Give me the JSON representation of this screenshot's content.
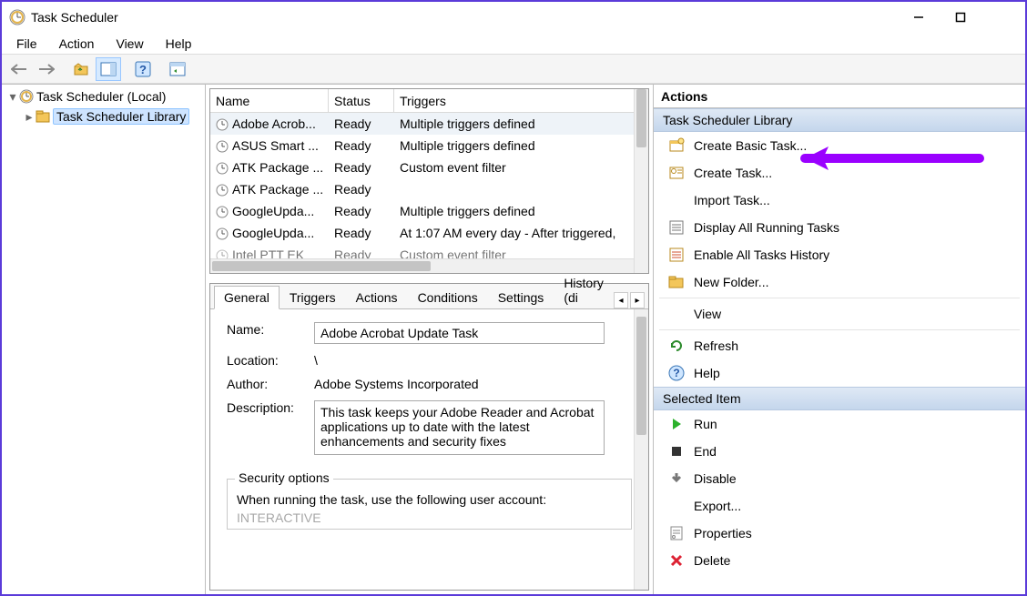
{
  "window": {
    "title": "Task Scheduler"
  },
  "menu": {
    "file": "File",
    "action": "Action",
    "view": "View",
    "help": "Help"
  },
  "tree": {
    "root": "Task Scheduler (Local)",
    "library": "Task Scheduler Library"
  },
  "table": {
    "headers": {
      "name": "Name",
      "status": "Status",
      "triggers": "Triggers"
    },
    "rows": [
      {
        "name": "Adobe Acrob...",
        "status": "Ready",
        "triggers": "Multiple triggers defined"
      },
      {
        "name": "ASUS Smart ...",
        "status": "Ready",
        "triggers": "Multiple triggers defined"
      },
      {
        "name": "ATK Package ...",
        "status": "Ready",
        "triggers": "Custom event filter"
      },
      {
        "name": "ATK Package ...",
        "status": "Ready",
        "triggers": ""
      },
      {
        "name": "GoogleUpda...",
        "status": "Ready",
        "triggers": "Multiple triggers defined"
      },
      {
        "name": "GoogleUpda...",
        "status": "Ready",
        "triggers": "At 1:07 AM every day - After triggered,"
      },
      {
        "name": "Intel PTT EK",
        "status": "Ready",
        "triggers": "Custom event filter"
      }
    ]
  },
  "details": {
    "tabs": {
      "general": "General",
      "triggers": "Triggers",
      "actions": "Actions",
      "conditions": "Conditions",
      "settings": "Settings",
      "history": "History (di"
    },
    "labels": {
      "name": "Name:",
      "location": "Location:",
      "author": "Author:",
      "description": "Description:",
      "security": "Security options",
      "securityText": "When running the task, use the following user account:",
      "interactive": "INTERACTIVE"
    },
    "values": {
      "name": "Adobe Acrobat Update Task",
      "location": "\\",
      "author": "Adobe Systems Incorporated",
      "description": "This task keeps your Adobe Reader and Acrobat applications up to date with the latest enhancements and security fixes"
    }
  },
  "actionsPane": {
    "header": "Actions",
    "sections": {
      "library": "Task Scheduler Library",
      "selected": "Selected Item"
    },
    "library": {
      "createBasic": "Create Basic Task...",
      "createTask": "Create Task...",
      "importTask": "Import Task...",
      "displayRunning": "Display All Running Tasks",
      "enableHistory": "Enable All Tasks History",
      "newFolder": "New Folder...",
      "view": "View",
      "refresh": "Refresh",
      "help": "Help"
    },
    "selected": {
      "run": "Run",
      "end": "End",
      "disable": "Disable",
      "export": "Export...",
      "properties": "Properties",
      "delete": "Delete"
    }
  }
}
